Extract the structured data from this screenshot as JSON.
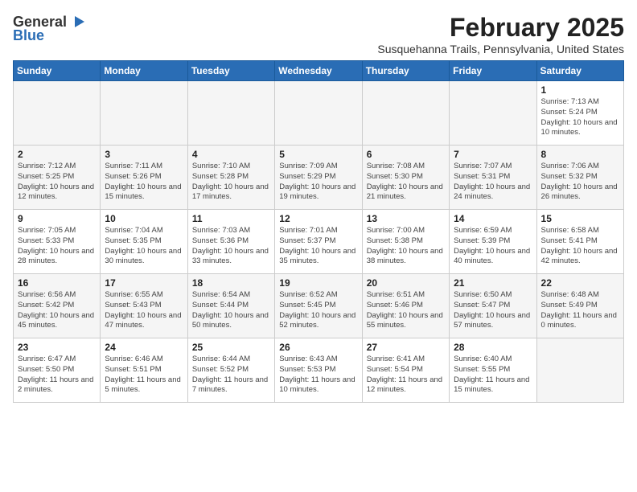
{
  "header": {
    "logo_general": "General",
    "logo_blue": "Blue",
    "month_title": "February 2025",
    "location": "Susquehanna Trails, Pennsylvania, United States"
  },
  "weekdays": [
    "Sunday",
    "Monday",
    "Tuesday",
    "Wednesday",
    "Thursday",
    "Friday",
    "Saturday"
  ],
  "weeks": [
    [
      {
        "day": "",
        "info": ""
      },
      {
        "day": "",
        "info": ""
      },
      {
        "day": "",
        "info": ""
      },
      {
        "day": "",
        "info": ""
      },
      {
        "day": "",
        "info": ""
      },
      {
        "day": "",
        "info": ""
      },
      {
        "day": "1",
        "info": "Sunrise: 7:13 AM\nSunset: 5:24 PM\nDaylight: 10 hours and 10 minutes."
      }
    ],
    [
      {
        "day": "2",
        "info": "Sunrise: 7:12 AM\nSunset: 5:25 PM\nDaylight: 10 hours and 12 minutes."
      },
      {
        "day": "3",
        "info": "Sunrise: 7:11 AM\nSunset: 5:26 PM\nDaylight: 10 hours and 15 minutes."
      },
      {
        "day": "4",
        "info": "Sunrise: 7:10 AM\nSunset: 5:28 PM\nDaylight: 10 hours and 17 minutes."
      },
      {
        "day": "5",
        "info": "Sunrise: 7:09 AM\nSunset: 5:29 PM\nDaylight: 10 hours and 19 minutes."
      },
      {
        "day": "6",
        "info": "Sunrise: 7:08 AM\nSunset: 5:30 PM\nDaylight: 10 hours and 21 minutes."
      },
      {
        "day": "7",
        "info": "Sunrise: 7:07 AM\nSunset: 5:31 PM\nDaylight: 10 hours and 24 minutes."
      },
      {
        "day": "8",
        "info": "Sunrise: 7:06 AM\nSunset: 5:32 PM\nDaylight: 10 hours and 26 minutes."
      }
    ],
    [
      {
        "day": "9",
        "info": "Sunrise: 7:05 AM\nSunset: 5:33 PM\nDaylight: 10 hours and 28 minutes."
      },
      {
        "day": "10",
        "info": "Sunrise: 7:04 AM\nSunset: 5:35 PM\nDaylight: 10 hours and 30 minutes."
      },
      {
        "day": "11",
        "info": "Sunrise: 7:03 AM\nSunset: 5:36 PM\nDaylight: 10 hours and 33 minutes."
      },
      {
        "day": "12",
        "info": "Sunrise: 7:01 AM\nSunset: 5:37 PM\nDaylight: 10 hours and 35 minutes."
      },
      {
        "day": "13",
        "info": "Sunrise: 7:00 AM\nSunset: 5:38 PM\nDaylight: 10 hours and 38 minutes."
      },
      {
        "day": "14",
        "info": "Sunrise: 6:59 AM\nSunset: 5:39 PM\nDaylight: 10 hours and 40 minutes."
      },
      {
        "day": "15",
        "info": "Sunrise: 6:58 AM\nSunset: 5:41 PM\nDaylight: 10 hours and 42 minutes."
      }
    ],
    [
      {
        "day": "16",
        "info": "Sunrise: 6:56 AM\nSunset: 5:42 PM\nDaylight: 10 hours and 45 minutes."
      },
      {
        "day": "17",
        "info": "Sunrise: 6:55 AM\nSunset: 5:43 PM\nDaylight: 10 hours and 47 minutes."
      },
      {
        "day": "18",
        "info": "Sunrise: 6:54 AM\nSunset: 5:44 PM\nDaylight: 10 hours and 50 minutes."
      },
      {
        "day": "19",
        "info": "Sunrise: 6:52 AM\nSunset: 5:45 PM\nDaylight: 10 hours and 52 minutes."
      },
      {
        "day": "20",
        "info": "Sunrise: 6:51 AM\nSunset: 5:46 PM\nDaylight: 10 hours and 55 minutes."
      },
      {
        "day": "21",
        "info": "Sunrise: 6:50 AM\nSunset: 5:47 PM\nDaylight: 10 hours and 57 minutes."
      },
      {
        "day": "22",
        "info": "Sunrise: 6:48 AM\nSunset: 5:49 PM\nDaylight: 11 hours and 0 minutes."
      }
    ],
    [
      {
        "day": "23",
        "info": "Sunrise: 6:47 AM\nSunset: 5:50 PM\nDaylight: 11 hours and 2 minutes."
      },
      {
        "day": "24",
        "info": "Sunrise: 6:46 AM\nSunset: 5:51 PM\nDaylight: 11 hours and 5 minutes."
      },
      {
        "day": "25",
        "info": "Sunrise: 6:44 AM\nSunset: 5:52 PM\nDaylight: 11 hours and 7 minutes."
      },
      {
        "day": "26",
        "info": "Sunrise: 6:43 AM\nSunset: 5:53 PM\nDaylight: 11 hours and 10 minutes."
      },
      {
        "day": "27",
        "info": "Sunrise: 6:41 AM\nSunset: 5:54 PM\nDaylight: 11 hours and 12 minutes."
      },
      {
        "day": "28",
        "info": "Sunrise: 6:40 AM\nSunset: 5:55 PM\nDaylight: 11 hours and 15 minutes."
      },
      {
        "day": "",
        "info": ""
      }
    ]
  ]
}
